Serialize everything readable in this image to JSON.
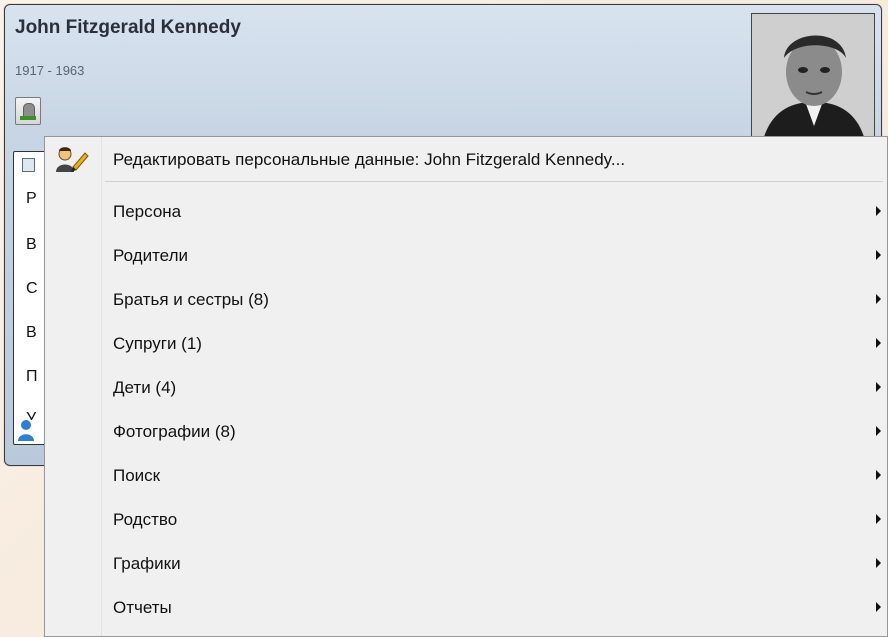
{
  "person": {
    "name": "John Fitzgerald Kennedy",
    "years": "1917 - 1963"
  },
  "facts_visible_letters": [
    "Р",
    "В",
    "С",
    "В",
    "П",
    "У"
  ],
  "icons": {
    "grave": "gravestone-icon",
    "edit": "person-edit-icon",
    "person": "person-icon",
    "submenu": "submenu-arrow-icon"
  },
  "menu": {
    "items": [
      {
        "label": "Редактировать персональные данные: John Fitzgerald Kennedy...",
        "submenu": false
      },
      {
        "label": "Персона",
        "submenu": true
      },
      {
        "label": "Родители",
        "submenu": true
      },
      {
        "label": "Братья и сестры (8)",
        "submenu": true
      },
      {
        "label": "Супруги (1)",
        "submenu": true
      },
      {
        "label": "Дети (4)",
        "submenu": true
      },
      {
        "label": "Фотографии (8)",
        "submenu": true
      },
      {
        "label": "Поиск",
        "submenu": true
      },
      {
        "label": "Родство",
        "submenu": true
      },
      {
        "label": "Графики",
        "submenu": true
      },
      {
        "label": "Отчеты",
        "submenu": true
      }
    ]
  }
}
